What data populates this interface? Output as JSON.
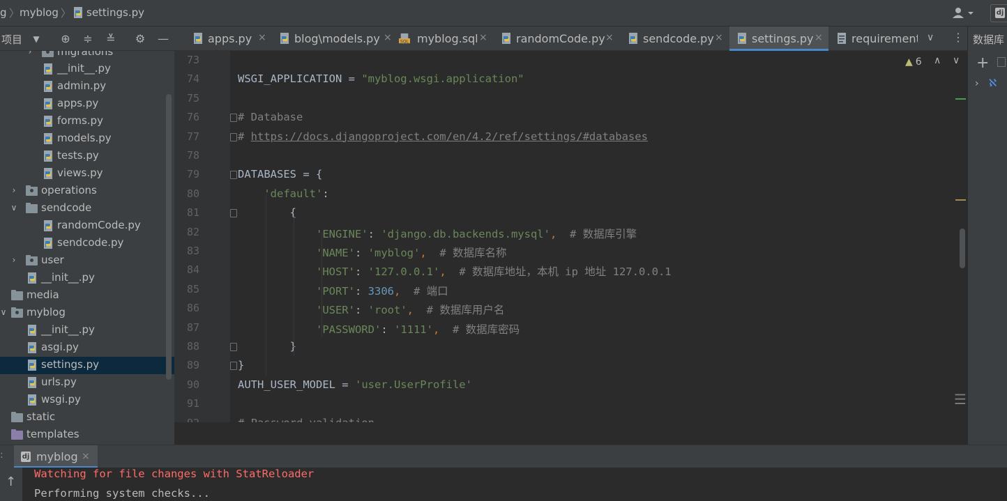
{
  "breadcrumb": {
    "root": "g",
    "project": "myblog",
    "file": "settings.py"
  },
  "project_panel": {
    "title": "项目",
    "tree": [
      {
        "label": "migrations",
        "kind": "folder-pkg",
        "depth": 2,
        "arrow": "collapsed"
      },
      {
        "label": "__init__.py",
        "kind": "py",
        "depth": 3
      },
      {
        "label": "admin.py",
        "kind": "py",
        "depth": 3
      },
      {
        "label": "apps.py",
        "kind": "py",
        "depth": 3
      },
      {
        "label": "forms.py",
        "kind": "py",
        "depth": 3
      },
      {
        "label": "models.py",
        "kind": "py",
        "depth": 3
      },
      {
        "label": "tests.py",
        "kind": "py",
        "depth": 3
      },
      {
        "label": "views.py",
        "kind": "py",
        "depth": 3
      },
      {
        "label": "operations",
        "kind": "folder-pkg",
        "depth": 1,
        "arrow": "collapsed"
      },
      {
        "label": "sendcode",
        "kind": "folder",
        "depth": 1,
        "arrow": "expanded"
      },
      {
        "label": "randomCode.py",
        "kind": "py",
        "depth": 3
      },
      {
        "label": "sendcode.py",
        "kind": "py",
        "depth": 3
      },
      {
        "label": "user",
        "kind": "folder-pkg",
        "depth": 1,
        "arrow": "collapsed"
      },
      {
        "label": "__init__.py",
        "kind": "py",
        "depth": 2
      },
      {
        "label": "media",
        "kind": "folder",
        "depth": 0
      },
      {
        "label": "myblog",
        "kind": "folder-pkg",
        "depth": 0,
        "arrow": "expanded"
      },
      {
        "label": "__init__.py",
        "kind": "py",
        "depth": 2
      },
      {
        "label": "asgi.py",
        "kind": "py",
        "depth": 2
      },
      {
        "label": "settings.py",
        "kind": "py",
        "depth": 2,
        "selected": true
      },
      {
        "label": "urls.py",
        "kind": "py",
        "depth": 2
      },
      {
        "label": "wsgi.py",
        "kind": "py",
        "depth": 2
      },
      {
        "label": "static",
        "kind": "folder",
        "depth": 0
      },
      {
        "label": "templates",
        "kind": "folder-purple",
        "depth": 0
      }
    ]
  },
  "tabs": [
    {
      "label": "apps.py",
      "icon": "python-file-icon",
      "active": false
    },
    {
      "label": "blog\\models.py",
      "icon": "python-file-icon",
      "active": false
    },
    {
      "label": "myblog.sql",
      "icon": "sql-file-icon",
      "active": false
    },
    {
      "label": "randomCode.py",
      "icon": "python-file-icon",
      "active": false
    },
    {
      "label": "sendcode.py",
      "icon": "python-file-icon",
      "active": false
    },
    {
      "label": "settings.py",
      "icon": "python-file-icon",
      "active": true
    },
    {
      "label": "requirements",
      "icon": "text-file-icon",
      "active": false
    }
  ],
  "editor": {
    "warning_count": "6",
    "lines": [
      {
        "n": "73",
        "tokens": []
      },
      {
        "n": "74",
        "tokens": [
          {
            "t": "WSGI_APPLICATION = ",
            "c": ""
          },
          {
            "t": "\"myblog.wsgi.application\"",
            "c": "str"
          }
        ]
      },
      {
        "n": "75",
        "tokens": []
      },
      {
        "n": "76",
        "tokens": [
          {
            "t": "# Database",
            "c": "cmt"
          }
        ]
      },
      {
        "n": "77",
        "tokens": [
          {
            "t": "# ",
            "c": "cmt"
          },
          {
            "t": "https://docs.djangoproject.com/en/4.2/ref/settings/#databases",
            "c": "link"
          }
        ]
      },
      {
        "n": "78",
        "tokens": []
      },
      {
        "n": "79",
        "tokens": [
          {
            "t": "DATABASES = {",
            "c": ""
          }
        ]
      },
      {
        "n": "80",
        "tokens": [
          {
            "t": "    ",
            "c": ""
          },
          {
            "t": "'default'",
            "c": "str"
          },
          {
            "t": ":",
            "c": ""
          }
        ]
      },
      {
        "n": "81",
        "tokens": [
          {
            "t": "        {",
            "c": ""
          }
        ]
      },
      {
        "n": "82",
        "tokens": [
          {
            "t": "            ",
            "c": ""
          },
          {
            "t": "'ENGINE'",
            "c": "str"
          },
          {
            "t": ": ",
            "c": ""
          },
          {
            "t": "'django.db.backends.mysql'",
            "c": "str"
          },
          {
            "t": ",  ",
            "c": "kw"
          },
          {
            "t": "# 数据库引擎",
            "c": "cmt"
          }
        ]
      },
      {
        "n": "83",
        "tokens": [
          {
            "t": "            ",
            "c": ""
          },
          {
            "t": "'NAME'",
            "c": "str"
          },
          {
            "t": ": ",
            "c": ""
          },
          {
            "t": "'myblog'",
            "c": "str"
          },
          {
            "t": ",  ",
            "c": "kw"
          },
          {
            "t": "# 数据库名称",
            "c": "cmt"
          }
        ]
      },
      {
        "n": "84",
        "tokens": [
          {
            "t": "            ",
            "c": ""
          },
          {
            "t": "'HOST'",
            "c": "str"
          },
          {
            "t": ": ",
            "c": ""
          },
          {
            "t": "'127.0.0.1'",
            "c": "str"
          },
          {
            "t": ",  ",
            "c": "kw"
          },
          {
            "t": "# 数据库地址，本机 ip 地址 127.0.0.1",
            "c": "cmt"
          }
        ]
      },
      {
        "n": "85",
        "tokens": [
          {
            "t": "            ",
            "c": ""
          },
          {
            "t": "'PORT'",
            "c": "str"
          },
          {
            "t": ": ",
            "c": ""
          },
          {
            "t": "3306",
            "c": "num"
          },
          {
            "t": ",  ",
            "c": "kw"
          },
          {
            "t": "# 端口",
            "c": "cmt"
          }
        ]
      },
      {
        "n": "86",
        "tokens": [
          {
            "t": "            ",
            "c": ""
          },
          {
            "t": "'USER'",
            "c": "str"
          },
          {
            "t": ": ",
            "c": ""
          },
          {
            "t": "'root'",
            "c": "str"
          },
          {
            "t": ",  ",
            "c": "kw"
          },
          {
            "t": "# 数据库用户名",
            "c": "cmt"
          }
        ]
      },
      {
        "n": "87",
        "tokens": [
          {
            "t": "            ",
            "c": ""
          },
          {
            "t": "'PASSWORD'",
            "c": "str"
          },
          {
            "t": ": ",
            "c": ""
          },
          {
            "t": "'1111'",
            "c": "str"
          },
          {
            "t": ",  ",
            "c": "kw"
          },
          {
            "t": "# 数据库密码",
            "c": "cmt"
          }
        ]
      },
      {
        "n": "88",
        "tokens": [
          {
            "t": "        }",
            "c": ""
          }
        ]
      },
      {
        "n": "89",
        "tokens": [
          {
            "t": "}",
            "c": ""
          }
        ]
      },
      {
        "n": "90",
        "tokens": [
          {
            "t": "AUTH_USER_MODEL = ",
            "c": ""
          },
          {
            "t": "'user.UserProfile'",
            "c": "str"
          }
        ]
      },
      {
        "n": "91",
        "tokens": []
      },
      {
        "n": "92",
        "tokens": [
          {
            "t": "# Password validation",
            "c": "cmt"
          }
        ]
      }
    ]
  },
  "right_panel": {
    "title": "数据库"
  },
  "run_panel": {
    "tab_label": "myblog",
    "lines": [
      {
        "text": "Watching for file changes with StatReloader",
        "color": "#ff6b68"
      },
      {
        "text": "Performing system checks...",
        "color": "#bbbbbb"
      }
    ]
  },
  "colors": {
    "accent": "#4a88c7",
    "selection": "#0d293e",
    "string": "#6a8759",
    "keyword": "#cc7832",
    "number": "#6897bb",
    "comment": "#808080"
  }
}
